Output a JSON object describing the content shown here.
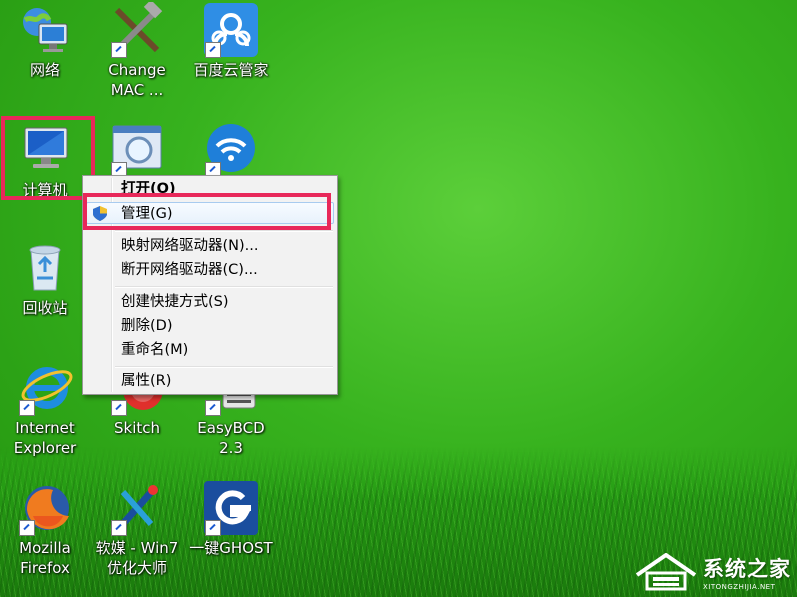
{
  "desktop": {
    "icons": [
      {
        "label": "网络",
        "icon": "network-icon"
      },
      {
        "label": "Change\nMAC ...",
        "icon": "tools-icon"
      },
      {
        "label": "百度云管家",
        "icon": "baidu-cloud-icon"
      },
      {
        "label": "计算机",
        "icon": "computer-icon"
      },
      {
        "label": "",
        "icon": "magnifier-app-icon"
      },
      {
        "label": "",
        "icon": "wifi-app-icon"
      },
      {
        "label": "回收站",
        "icon": "recycle-bin-icon"
      },
      {
        "label": "Internet\nExplorer",
        "icon": "ie-icon"
      },
      {
        "label": "Skitch",
        "icon": "skitch-icon"
      },
      {
        "label": "EasyBCD\n2.3",
        "icon": "easybcd-icon"
      },
      {
        "label": "Mozilla\nFirefox",
        "icon": "firefox-icon"
      },
      {
        "label": "软媒 - Win7\n优化大师",
        "icon": "win7-optimizer-icon"
      },
      {
        "label": "一键GHOST",
        "icon": "ghost-icon"
      }
    ]
  },
  "context_menu": {
    "items": {
      "open": "打开(O)",
      "manage": "管理(G)",
      "map_drive": "映射网络驱动器(N)...",
      "disconnect_drive": "断开网络驱动器(C)...",
      "create_shortcut": "创建快捷方式(S)",
      "delete": "删除(D)",
      "rename": "重命名(M)",
      "properties": "属性(R)"
    }
  },
  "watermark": {
    "name": "系统之家",
    "url": "XITONGZHIJIA.NET"
  },
  "colors": {
    "highlight": "#e8285a",
    "desktop_green": "#37b21e"
  }
}
